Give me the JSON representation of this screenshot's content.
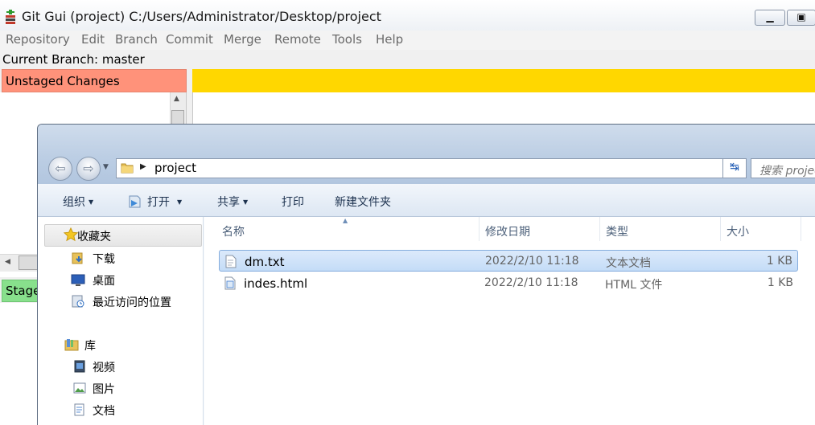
{
  "gitgui": {
    "title": "Git Gui (project) C:/Users/Administrator/Desktop/project",
    "menu": [
      "Repository",
      "Edit",
      "Branch",
      "Commit",
      "Merge",
      "Remote",
      "Tools",
      "Help"
    ],
    "current_branch": "Current Branch: master",
    "unstaged_header": "Unstaged Changes",
    "staged_header": "Staged Changes (Will Commit)",
    "colors": {
      "unstaged": "#ff927a",
      "diff_header": "#ffd700",
      "staged": "#88e08c"
    }
  },
  "explorer": {
    "address": "project",
    "search_placeholder": "搜索 project",
    "toolbar": {
      "organize": "组织",
      "open": "打开",
      "share": "共享",
      "print": "打印",
      "new_folder": "新建文件夹"
    },
    "nav": {
      "favorites": "收藏夹",
      "favorites_items": [
        "下载",
        "桌面",
        "最近访问的位置"
      ],
      "library": "库",
      "library_items": [
        "视频",
        "图片",
        "文档"
      ]
    },
    "columns": [
      "名称",
      "修改日期",
      "类型",
      "大小"
    ],
    "files": [
      {
        "name": "dm.txt",
        "date": "2022/2/10 11:18",
        "type": "文本文档",
        "size": "1 KB",
        "selected": true,
        "icon": "text-file-icon"
      },
      {
        "name": "indes.html",
        "date": "2022/2/10 11:18",
        "type": "HTML 文件",
        "size": "1 KB",
        "selected": false,
        "icon": "html-file-icon"
      }
    ]
  }
}
